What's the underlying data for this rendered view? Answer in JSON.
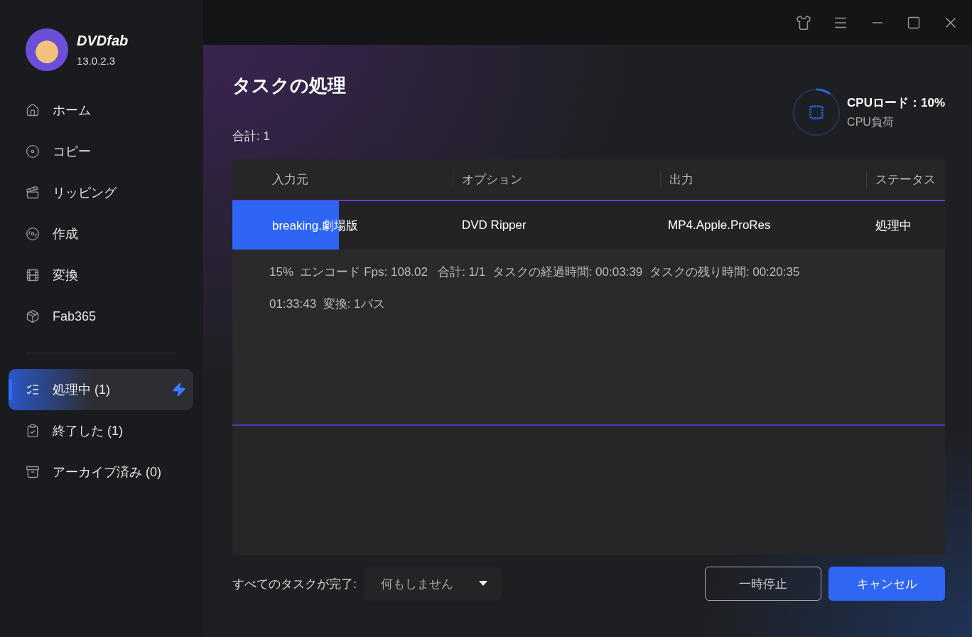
{
  "app": {
    "name": "DVDfab",
    "version": "13.0.2.3"
  },
  "sidebar": {
    "items": [
      {
        "label": "ホーム",
        "selected": false
      },
      {
        "label": "コピー",
        "selected": false
      },
      {
        "label": "リッピング",
        "selected": false
      },
      {
        "label": "作成",
        "selected": false
      },
      {
        "label": "変換",
        "selected": false
      },
      {
        "label": "Fab365",
        "selected": false
      }
    ],
    "tasks": [
      {
        "label": "処理中 (1)",
        "selected": true,
        "boost": true
      },
      {
        "label": "終了した (1)",
        "selected": false,
        "boost": false
      },
      {
        "label": "アーカイブ済み (0)",
        "selected": false,
        "boost": false
      }
    ]
  },
  "page": {
    "title": "タスクの処理",
    "total": "合計: 1"
  },
  "cpu": {
    "label": "CPUロード：10%",
    "sublabel": "CPU負荷",
    "level": 0.1
  },
  "table": {
    "columns": [
      "入力元",
      "オプション",
      "出力",
      "ステータス"
    ],
    "rows": [
      {
        "input": "breaking.劇場版",
        "option": "DVD Ripper",
        "output": "MP4.Apple.ProRes",
        "status": "処理中",
        "level": 0.15,
        "details": [
          "15%  エンコード Fps: 108.02   合計: 1/1  タスクの経過時間: 00:03:39  タスクの残り時間: 00:20:35",
          "01:33:43  変換: 1パス"
        ]
      }
    ]
  },
  "footer": {
    "after_label": "すべてのタスクが完了:",
    "after_value": "何もしません",
    "buttons": [
      {
        "kind": "secondary",
        "label": "一時停止"
      },
      {
        "kind": "primary",
        "label": "キャンセル"
      }
    ]
  }
}
